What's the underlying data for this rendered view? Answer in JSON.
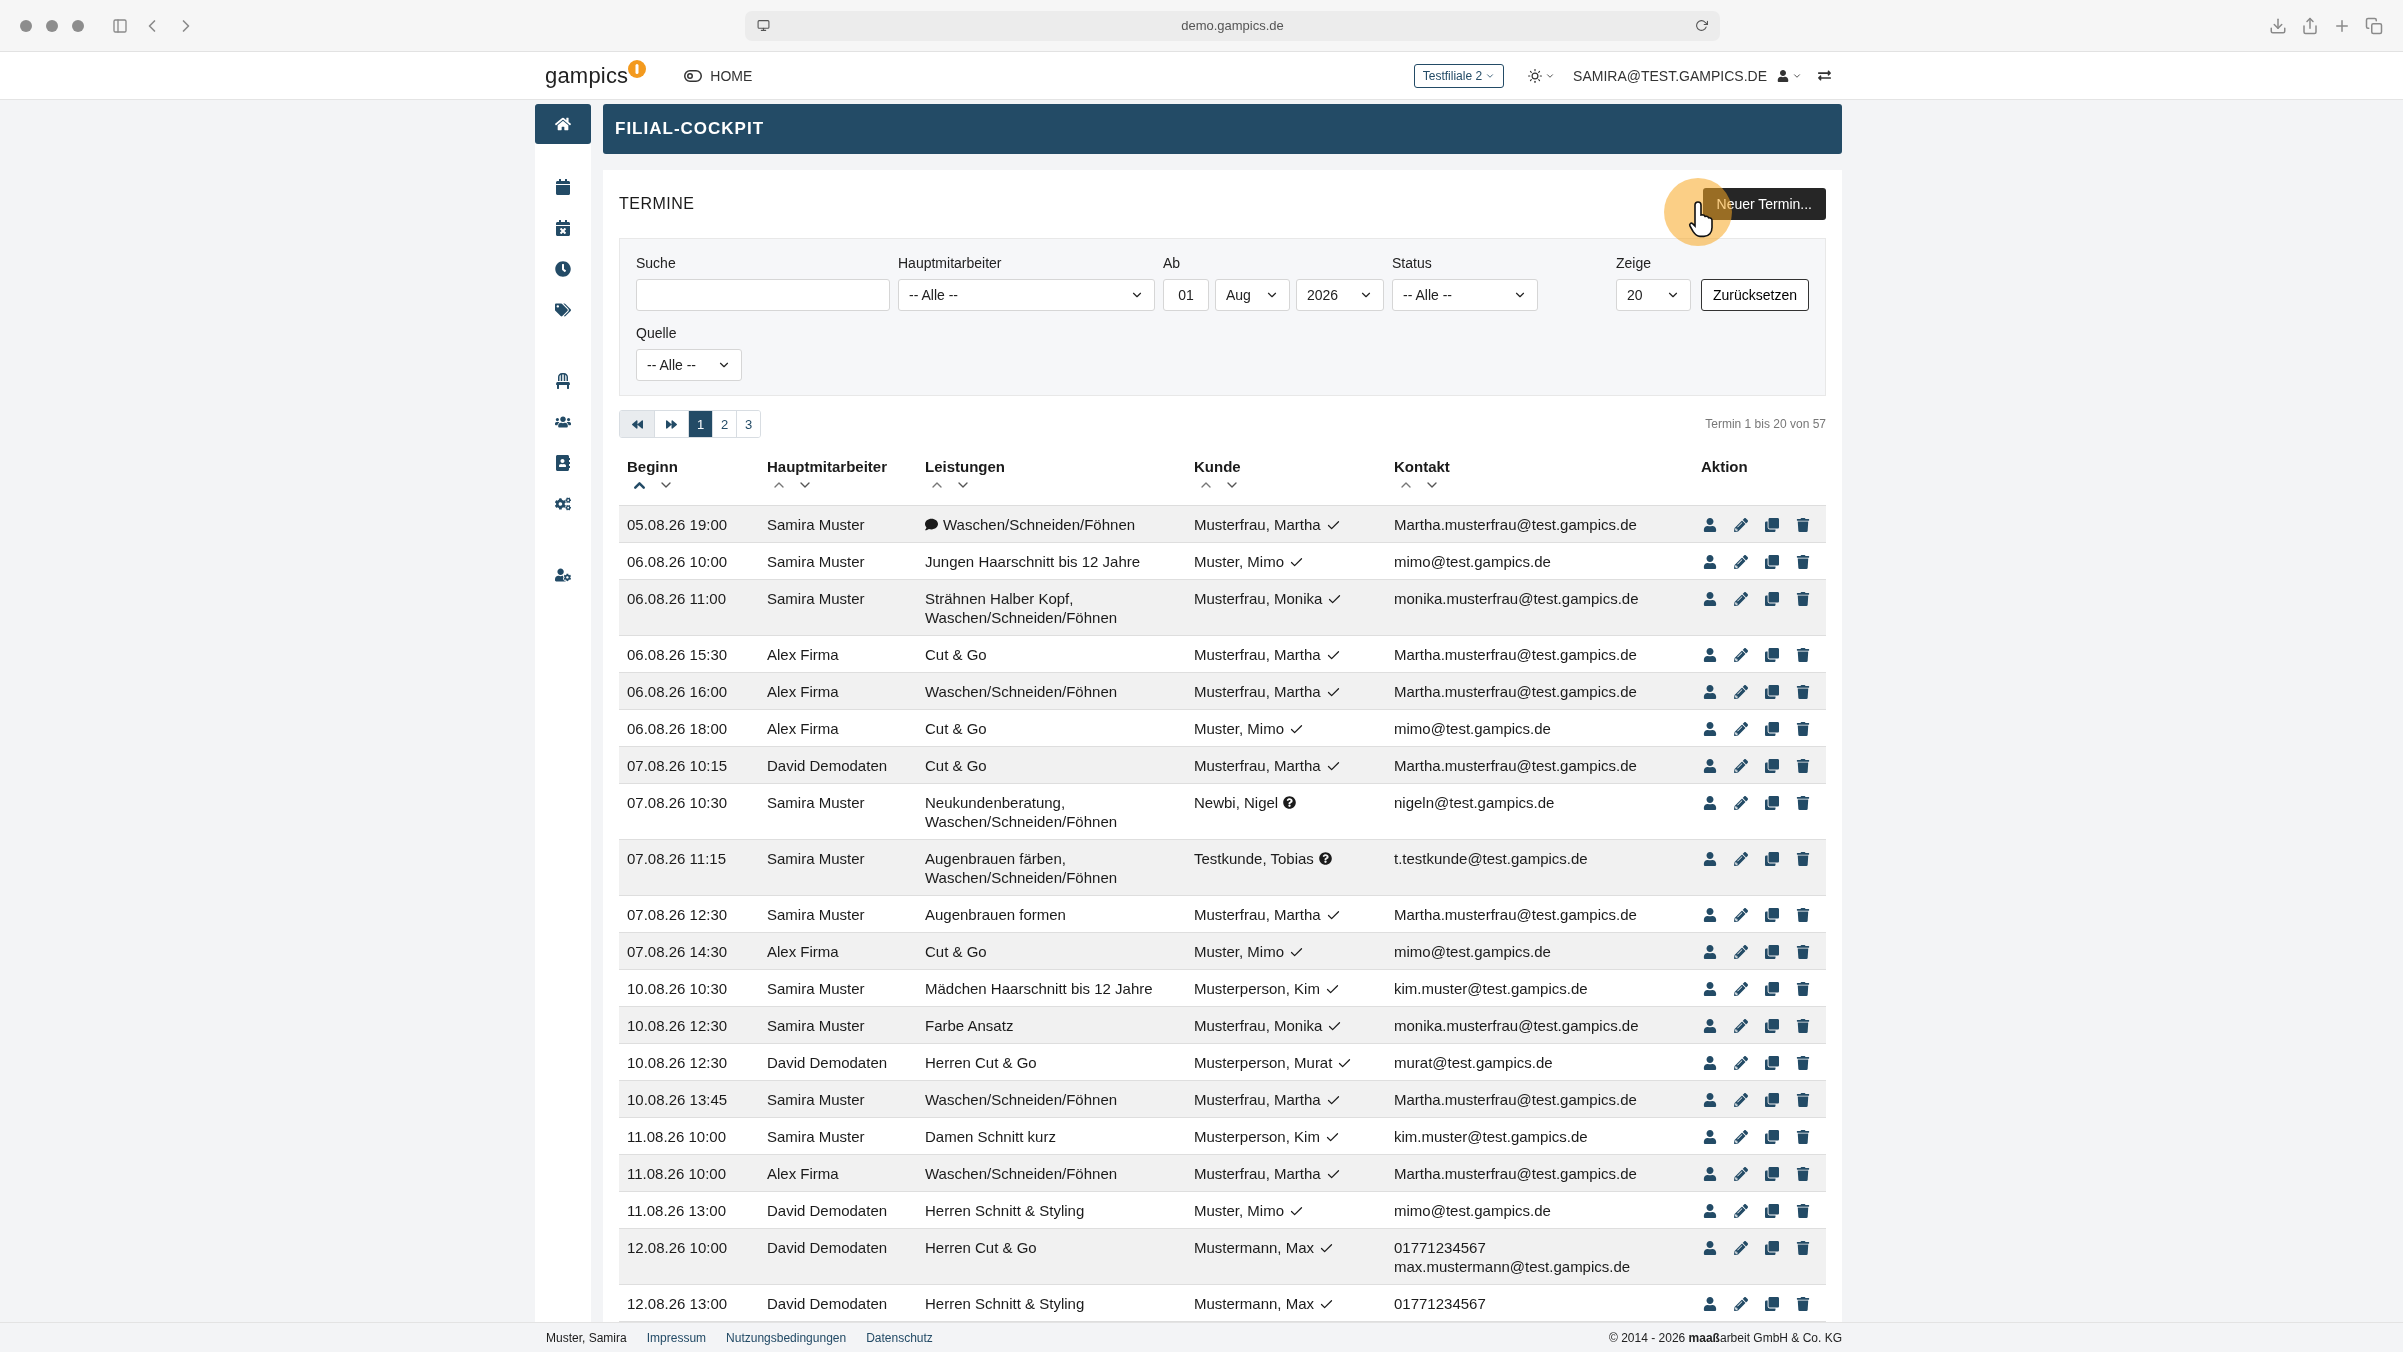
{
  "browser": {
    "url": "demo.gampics.de"
  },
  "header": {
    "logo": "gampics",
    "home": "HOME",
    "branch": "Testfiliale 2",
    "user": "SAMIRA@TEST.GAMPICS.DE"
  },
  "sidebar": {
    "items": [
      {
        "selected": true
      },
      {
        "selected": false
      },
      {
        "selected": false
      },
      {
        "selected": false
      },
      {
        "selected": false
      },
      {
        "selected": false
      },
      {
        "selected": false
      },
      {
        "selected": false
      },
      {
        "selected": false
      },
      {
        "selected": false
      }
    ]
  },
  "banner": {
    "title": "FILIAL-COCKPIT"
  },
  "card": {
    "title": "TERMINE",
    "new_button": "Neuer Termin..."
  },
  "filters": [
    {
      "kind": "text",
      "label": "Suche"
    },
    {
      "kind": "select",
      "label": "Hauptmitarbeiter",
      "value": "-- Alle --"
    },
    {
      "kind": "date",
      "label": "Ab",
      "day": "01",
      "month": "Aug",
      "year": "2026"
    },
    {
      "kind": "select",
      "label": "Status",
      "value": "-- Alle --"
    },
    {
      "kind": "select",
      "label": "Zeige",
      "value": "20"
    }
  ],
  "reset_button": "Zurücksetzen",
  "source_filter": {
    "label": "Quelle",
    "value": "-- Alle --"
  },
  "pagination": {
    "pages": [
      {
        "label": "1",
        "selected": true
      },
      {
        "label": "2",
        "selected": false
      },
      {
        "label": "3",
        "selected": false
      }
    ],
    "summary": "Termin 1 bis 20 von 57"
  },
  "table": {
    "columns": [
      {
        "label": "Beginn",
        "sortable": true,
        "sorted_ascending": true
      },
      {
        "label": "Hauptmitarbeiter",
        "sortable": true,
        "sorted_ascending": false
      },
      {
        "label": "Leistungen",
        "sortable": true,
        "sorted_ascending": false
      },
      {
        "label": "Kunde",
        "sortable": true,
        "sorted_ascending": false
      },
      {
        "label": "Kontakt",
        "sortable": true,
        "sorted_ascending": false
      },
      {
        "label": "Aktion",
        "sortable": false
      }
    ],
    "rows": [
      {
        "start": "05.08.26 19:00",
        "employee": "Samira Muster",
        "note": true,
        "services": "Waschen/Schneiden/Föhnen",
        "customer": "Musterfrau, Martha",
        "confirmed": true,
        "contact": [
          "Martha.musterfrau@test.gampics.de"
        ]
      },
      {
        "start": "06.08.26 10:00",
        "employee": "Samira Muster",
        "note": false,
        "services": "Jungen Haarschnitt bis 12 Jahre",
        "customer": "Muster, Mimo",
        "confirmed": true,
        "contact": [
          "mimo@test.gampics.de"
        ]
      },
      {
        "start": "06.08.26 11:00",
        "employee": "Samira Muster",
        "note": false,
        "services": "Strähnen Halber Kopf, Waschen/Schneiden/Föhnen",
        "customer": "Musterfrau, Monika",
        "confirmed": true,
        "contact": [
          "monika.musterfrau@test.gampics.de"
        ]
      },
      {
        "start": "06.08.26 15:30",
        "employee": "Alex Firma",
        "note": false,
        "services": "Cut & Go",
        "customer": "Musterfrau, Martha",
        "confirmed": true,
        "contact": [
          "Martha.musterfrau@test.gampics.de"
        ]
      },
      {
        "start": "06.08.26 16:00",
        "employee": "Alex Firma",
        "note": false,
        "services": "Waschen/Schneiden/Föhnen",
        "customer": "Musterfrau, Martha",
        "confirmed": true,
        "contact": [
          "Martha.musterfrau@test.gampics.de"
        ]
      },
      {
        "start": "06.08.26 18:00",
        "employee": "Alex Firma",
        "note": false,
        "services": "Cut & Go",
        "customer": "Muster, Mimo",
        "confirmed": true,
        "contact": [
          "mimo@test.gampics.de"
        ]
      },
      {
        "start": "07.08.26 10:15",
        "employee": "David Demodaten",
        "note": false,
        "services": "Cut & Go",
        "customer": "Musterfrau, Martha",
        "confirmed": true,
        "contact": [
          "Martha.musterfrau@test.gampics.de"
        ]
      },
      {
        "start": "07.08.26 10:30",
        "employee": "Samira Muster",
        "note": false,
        "services": "Neukundenberatung, Waschen/Schneiden/Föhnen",
        "customer": "Newbi, Nigel",
        "confirmed": false,
        "contact": [
          "nigeln@test.gampics.de"
        ]
      },
      {
        "start": "07.08.26 11:15",
        "employee": "Samira Muster",
        "note": false,
        "services": "Augenbrauen färben, Waschen/Schneiden/Föhnen",
        "customer": "Testkunde, Tobias",
        "confirmed": false,
        "contact": [
          "t.testkunde@test.gampics.de"
        ]
      },
      {
        "start": "07.08.26 12:30",
        "employee": "Samira Muster",
        "note": false,
        "services": "Augenbrauen formen",
        "customer": "Musterfrau, Martha",
        "confirmed": true,
        "contact": [
          "Martha.musterfrau@test.gampics.de"
        ]
      },
      {
        "start": "07.08.26 14:30",
        "employee": "Alex Firma",
        "note": false,
        "services": "Cut & Go",
        "customer": "Muster, Mimo",
        "confirmed": true,
        "contact": [
          "mimo@test.gampics.de"
        ]
      },
      {
        "start": "10.08.26 10:30",
        "employee": "Samira Muster",
        "note": false,
        "services": "Mädchen Haarschnitt bis 12 Jahre",
        "customer": "Musterperson, Kim",
        "confirmed": true,
        "contact": [
          "kim.muster@test.gampics.de"
        ]
      },
      {
        "start": "10.08.26 12:30",
        "employee": "Samira Muster",
        "note": false,
        "services": "Farbe Ansatz",
        "customer": "Musterfrau, Monika",
        "confirmed": true,
        "contact": [
          "monika.musterfrau@test.gampics.de"
        ]
      },
      {
        "start": "10.08.26 12:30",
        "employee": "David Demodaten",
        "note": false,
        "services": "Herren Cut & Go",
        "customer": "Musterperson, Murat",
        "confirmed": true,
        "contact": [
          "murat@test.gampics.de"
        ]
      },
      {
        "start": "10.08.26 13:45",
        "employee": "Samira Muster",
        "note": false,
        "services": "Waschen/Schneiden/Föhnen",
        "customer": "Musterfrau, Martha",
        "confirmed": true,
        "contact": [
          "Martha.musterfrau@test.gampics.de"
        ]
      },
      {
        "start": "11.08.26 10:00",
        "employee": "Samira Muster",
        "note": false,
        "services": "Damen Schnitt kurz",
        "customer": "Musterperson, Kim",
        "confirmed": true,
        "contact": [
          "kim.muster@test.gampics.de"
        ]
      },
      {
        "start": "11.08.26 10:00",
        "employee": "Alex Firma",
        "note": false,
        "services": "Waschen/Schneiden/Föhnen",
        "customer": "Musterfrau, Martha",
        "confirmed": true,
        "contact": [
          "Martha.musterfrau@test.gampics.de"
        ]
      },
      {
        "start": "11.08.26 13:00",
        "employee": "David Demodaten",
        "note": false,
        "services": "Herren Schnitt & Styling",
        "customer": "Muster, Mimo",
        "confirmed": true,
        "contact": [
          "mimo@test.gampics.de"
        ]
      },
      {
        "start": "12.08.26 10:00",
        "employee": "David Demodaten",
        "note": false,
        "services": "Herren Cut & Go",
        "customer": "Mustermann, Max",
        "confirmed": true,
        "contact": [
          "01771234567",
          "max.mustermann@test.gampics.de"
        ]
      },
      {
        "start": "12.08.26 13:00",
        "employee": "David Demodaten",
        "note": false,
        "services": "Herren Schnitt & Styling",
        "customer": "Mustermann, Max",
        "confirmed": true,
        "contact": [
          "01771234567"
        ]
      }
    ]
  },
  "footer": {
    "user": "Muster, Samira",
    "links": [
      "Impressum",
      "Nutzungsbedingungen",
      "Datenschutz"
    ],
    "copyright": "© 2014 - 2026 **maaß**arbeit GmbH & Co. KG"
  }
}
